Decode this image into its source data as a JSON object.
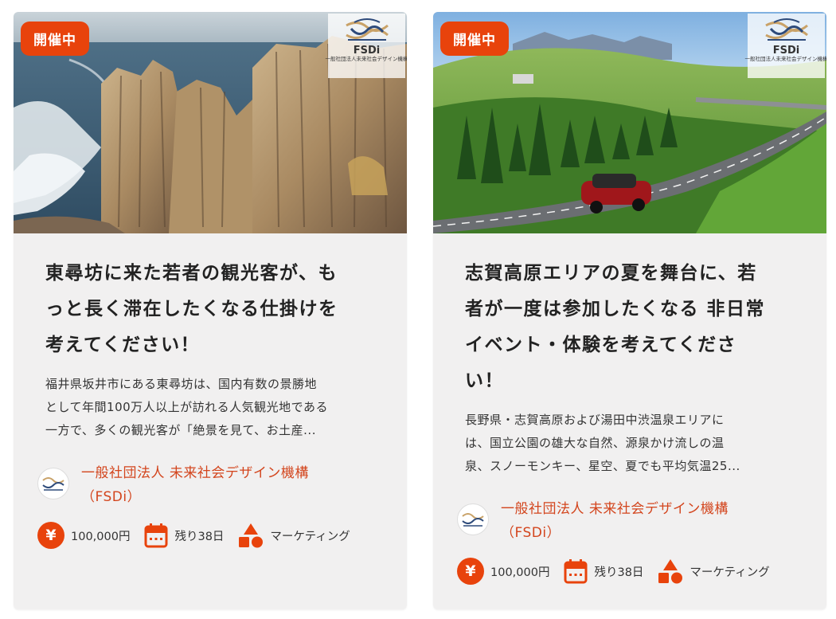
{
  "cards": [
    {
      "status": "開催中",
      "logo": {
        "title": "FSDi",
        "subtitle": "一般社団法人未来社会デザイン機構"
      },
      "title_lines": [
        "東尋坊に来た若者の観光客が、も",
        "っと長く滞在したくなる仕掛けを",
        "考えてください！"
      ],
      "desc_lines": [
        "福井県坂井市にある東尋坊は、国内有数の景勝地",
        "として年間100万人以上が訪れる人気観光地である",
        "一方で、多くの観光客が「絶景を見て、お土産..."
      ],
      "org_lines": [
        "一般社団法人 未来社会デザイン機構",
        "（FSDi）"
      ],
      "reward": "100,000円",
      "remaining": "残り38日",
      "category": "マーケティング"
    },
    {
      "status": "開催中",
      "logo": {
        "title": "FSDi",
        "subtitle": "一般社団法人未来社会デザイン機構"
      },
      "title_lines": [
        "志賀高原エリアの夏を舞台に、若",
        "者が一度は参加したくなる 非日常",
        "イベント・体験を考えてくださ",
        "い！"
      ],
      "desc_lines": [
        "長野県・志賀高原および湯田中渋温泉エリアに",
        "は、国立公園の雄大な自然、源泉かけ流しの温",
        "泉、スノーモンキー、星空、夏でも平均気温25..."
      ],
      "org_lines": [
        "一般社団法人 未来社会デザイン機構",
        "（FSDi）"
      ],
      "reward": "100,000円",
      "remaining": "残り38日",
      "category": "マーケティング"
    }
  ],
  "icons": {
    "reward": "yen-circle-icon",
    "remaining": "calendar-icon",
    "category": "shapes-icon"
  },
  "colors": {
    "accent": "#e8430c",
    "org_text": "#d3451d",
    "card_bg": "#f1f0f0"
  }
}
